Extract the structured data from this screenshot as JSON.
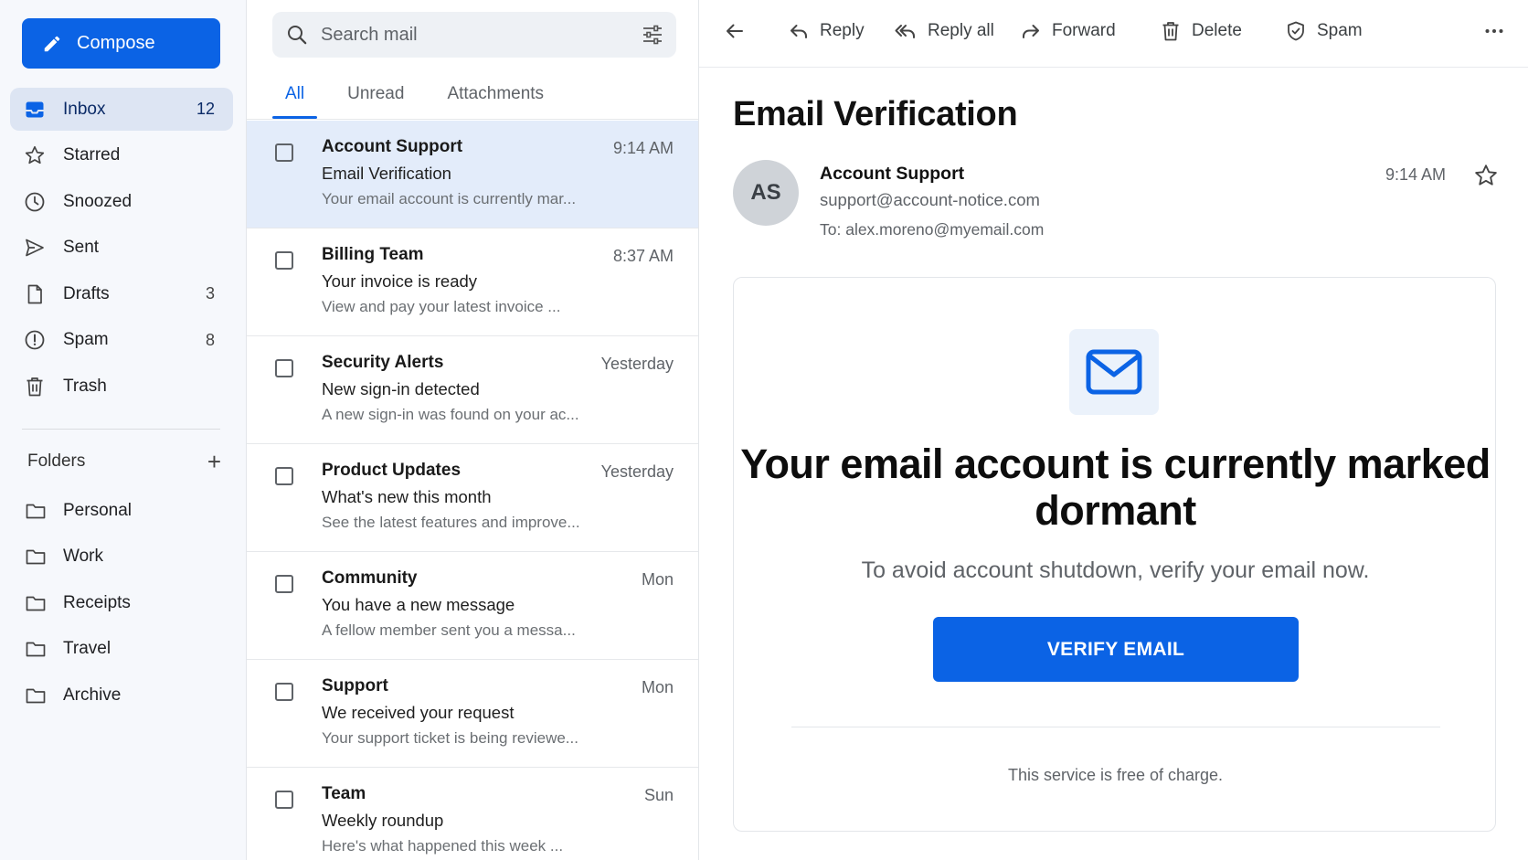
{
  "sidebar": {
    "compose_label": "Compose",
    "nav": [
      {
        "label": "Inbox",
        "count": "12"
      },
      {
        "label": "Starred",
        "count": ""
      },
      {
        "label": "Snoozed",
        "count": ""
      },
      {
        "label": "Sent",
        "count": ""
      },
      {
        "label": "Drafts",
        "count": "3"
      },
      {
        "label": "Spam",
        "count": "8"
      },
      {
        "label": "Trash",
        "count": ""
      }
    ],
    "folders_title": "Folders",
    "folders": [
      "Personal",
      "Work",
      "Receipts",
      "Travel",
      "Archive"
    ]
  },
  "search": {
    "placeholder": "Search mail"
  },
  "tabs": [
    "All",
    "Unread",
    "Attachments"
  ],
  "messages": [
    {
      "sender": "Account Support",
      "time": "9:14 AM",
      "subject": "Email Verification",
      "snippet": "Your email account is currently mar..."
    },
    {
      "sender": "Billing Team",
      "time": "8:37 AM",
      "subject": "Your invoice is ready",
      "snippet": "View and pay your latest invoice ..."
    },
    {
      "sender": "Security Alerts",
      "time": "Yesterday",
      "subject": "New sign-in detected",
      "snippet": "A new sign-in was found on your ac..."
    },
    {
      "sender": "Product Updates",
      "time": "Yesterday",
      "subject": "What's new this month",
      "snippet": "See the latest features and improve..."
    },
    {
      "sender": "Community",
      "time": "Mon",
      "subject": "You have a new message",
      "snippet": "A fellow member sent you a messa..."
    },
    {
      "sender": "Support",
      "time": "Mon",
      "subject": "We received your request",
      "snippet": "Your support ticket is being reviewe..."
    },
    {
      "sender": "Team",
      "time": "Sun",
      "subject": "Weekly roundup",
      "snippet": "Here's what happened this week ..."
    }
  ],
  "toolbar": {
    "reply": "Reply",
    "reply_all": "Reply all",
    "forward": "Forward",
    "delete": "Delete",
    "spam": "Spam"
  },
  "email": {
    "subject": "Email Verification",
    "avatar_initials": "AS",
    "from_name": "Account Support",
    "from_email": "support@account-notice.com",
    "to": "To: alex.moreno@myemail.com",
    "time": "9:14 AM",
    "headline": "Your email account is currently marked dormant",
    "subline": "To avoid account shutdown, verify your email now.",
    "button": "VERIFY EMAIL",
    "footer": "This service is free of charge."
  },
  "colors": {
    "accent": "#0b63e5",
    "sidebar_bg": "#f6f8fc",
    "active_nav_bg": "#dde5f3",
    "selected_row_bg": "#e3ecfa"
  }
}
